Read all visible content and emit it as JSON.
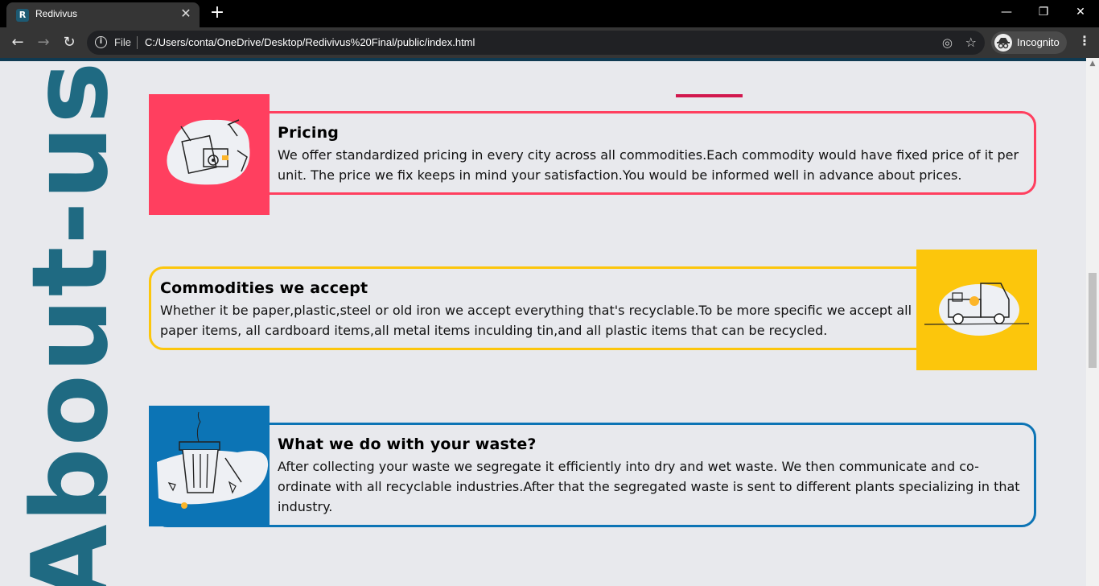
{
  "browser": {
    "tab_title": "Redivivus",
    "favicon_letter": "R",
    "address": {
      "scheme_label": "File",
      "url": "C:/Users/conta/OneDrive/Desktop/Redivivus%20Final/public/index.html"
    },
    "profile_label": "Incognito"
  },
  "page": {
    "side_title": "About-us",
    "colors": {
      "pricing": "#ff3f5f",
      "commodities": "#fcc60c",
      "waste": "#0c74b5",
      "side_title": "#1f6a82",
      "accent": "#d2184e"
    },
    "cards": [
      {
        "title": "Pricing",
        "text": "We offer standardized pricing in every city across all commodities.Each commodity would have fixed price of it per unit. The price we fix keeps in mind your satisfaction.You would be informed well in advance about prices.",
        "icon": "pricing-illustration-icon"
      },
      {
        "title": "Commodities we accept",
        "text": "Whether it be paper,plastic,steel or old iron we accept everything that's recyclable.To be more specific we accept all paper items, all cardboard items,all metal items inculding tin,and all plastic items that can be recycled.",
        "icon": "truck-illustration-icon"
      },
      {
        "title": "What we do with your waste?",
        "text": "After collecting your waste we segregate it efficiently into dry and wet waste. We then communicate and co-ordinate with all recyclable industries.After that the segregated waste is sent to different plants specializing in that industry.",
        "icon": "trash-can-illustration-icon"
      }
    ]
  }
}
